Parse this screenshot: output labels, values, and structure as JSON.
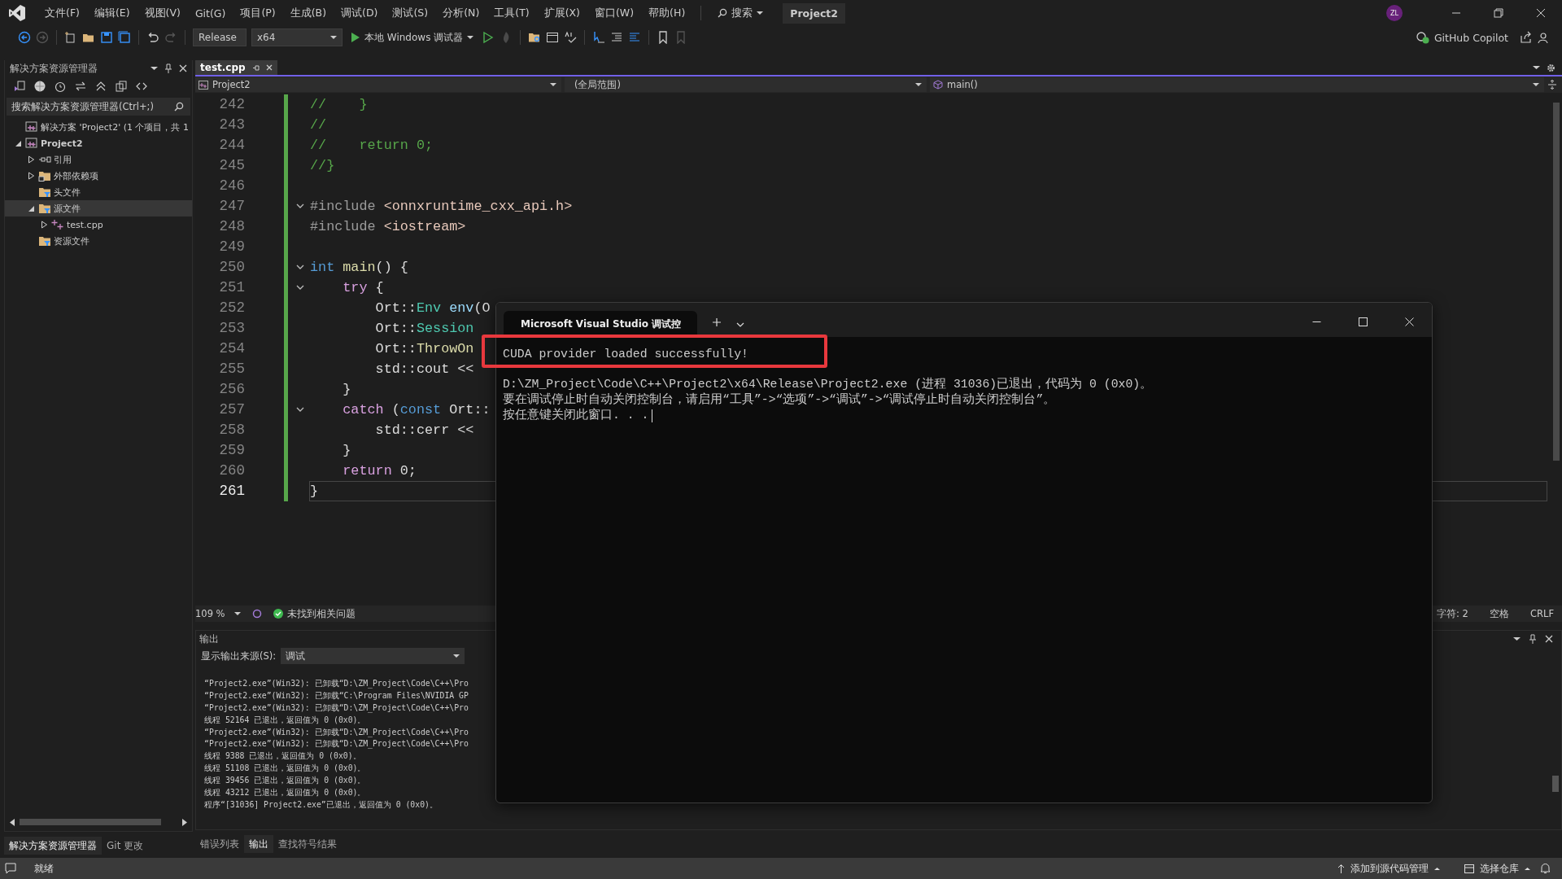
{
  "menu_bar": {
    "items": [
      "文件(F)",
      "编辑(E)",
      "视图(V)",
      "Git(G)",
      "项目(P)",
      "生成(B)",
      "调试(D)",
      "测试(S)",
      "分析(N)",
      "工具(T)",
      "扩展(X)",
      "窗口(W)",
      "帮助(H)"
    ],
    "search": "搜索",
    "title": "Project2",
    "avatar": "ZL"
  },
  "toolbar": {
    "configuration": "Release",
    "platform": "x64",
    "debugger": "本地 Windows 调试器",
    "copilot": "GitHub Copilot"
  },
  "solution_explorer": {
    "title": "解决方案资源管理器",
    "search_placeholder": "搜索解决方案资源管理器(Ctrl+;)",
    "tree": [
      {
        "label": "解决方案 'Project2' (1 个项目，共 1",
        "kind": "solution",
        "selected": false
      },
      {
        "label": "Project2",
        "kind": "project",
        "expanded": true,
        "selected": false,
        "children": [
          {
            "label": "引用",
            "kind": "references",
            "expanded": false,
            "selected": false
          },
          {
            "label": "外部依赖项",
            "kind": "external",
            "expanded": false,
            "selected": false
          },
          {
            "label": "头文件",
            "kind": "filter",
            "selected": false
          },
          {
            "label": "源文件",
            "kind": "filter",
            "expanded": true,
            "selected": true,
            "children": [
              {
                "label": "test.cpp",
                "kind": "cpp",
                "expanded": false,
                "selected": false
              }
            ]
          },
          {
            "label": "资源文件",
            "kind": "filter",
            "selected": false
          }
        ]
      }
    ]
  },
  "editor": {
    "tabs": [
      {
        "label": "test.cpp",
        "selected": true
      }
    ],
    "nav": {
      "project": "Project2",
      "scope": "(全局范围)",
      "member": "main()"
    },
    "lines": [
      {
        "num": "242",
        "current": false,
        "segs": [
          {
            "kind": "comment",
            "t": "//    }"
          }
        ]
      },
      {
        "num": "243",
        "current": false,
        "segs": [
          {
            "kind": "comment",
            "t": "//"
          }
        ]
      },
      {
        "num": "244",
        "current": false,
        "segs": [
          {
            "kind": "comment",
            "t": "//    return 0;"
          }
        ]
      },
      {
        "num": "245",
        "current": false,
        "segs": [
          {
            "kind": "comment",
            "t": "//}"
          }
        ]
      },
      {
        "num": "246",
        "current": false
      },
      {
        "num": "247",
        "fold": true,
        "current": false,
        "segs": [
          {
            "kind": "pre",
            "t": "#include "
          },
          {
            "kind": "inc",
            "t": "<onnxruntime_cxx_api.h>"
          }
        ]
      },
      {
        "num": "248",
        "current": false,
        "segs": [
          {
            "kind": "pre",
            "t": "#include "
          },
          {
            "kind": "inc",
            "t": "<iostream>"
          }
        ]
      },
      {
        "num": "249",
        "current": false
      },
      {
        "num": "250",
        "fold": true,
        "current": false,
        "segs": [
          {
            "kind": "kw",
            "t": "int "
          },
          {
            "kind": "fn",
            "t": "main"
          },
          {
            "kind": "plain",
            "t": "() {"
          }
        ]
      },
      {
        "num": "251",
        "fold": true,
        "current": false,
        "segs": [
          {
            "kind": "ctl",
            "t": "    try"
          },
          {
            "kind": "plain",
            "t": " {"
          }
        ]
      },
      {
        "num": "252",
        "current": false,
        "segs": [
          {
            "kind": "plain",
            "t": "        Ort::"
          },
          {
            "kind": "type",
            "t": "Env "
          },
          {
            "kind": "var",
            "t": "env"
          },
          {
            "kind": "plain",
            "t": "(O"
          }
        ]
      },
      {
        "num": "253",
        "current": false,
        "segs": [
          {
            "kind": "plain",
            "t": "        Ort::"
          },
          {
            "kind": "type",
            "t": "Session"
          }
        ]
      },
      {
        "num": "254",
        "current": false,
        "segs": [
          {
            "kind": "plain",
            "t": "        Ort::"
          },
          {
            "kind": "fn",
            "t": "ThrowOn"
          }
        ]
      },
      {
        "num": "255",
        "current": false,
        "segs": [
          {
            "kind": "plain",
            "t": "        std::cout <<"
          }
        ]
      },
      {
        "num": "256",
        "current": false,
        "segs": [
          {
            "kind": "plain",
            "t": "    }"
          }
        ]
      },
      {
        "num": "257",
        "fold": true,
        "current": false,
        "segs": [
          {
            "kind": "ctl",
            "t": "    catch"
          },
          {
            "kind": "plain",
            "t": " ("
          },
          {
            "kind": "kw",
            "t": "const"
          },
          {
            "kind": "plain",
            "t": " Ort::"
          }
        ]
      },
      {
        "num": "258",
        "current": false,
        "segs": [
          {
            "kind": "plain",
            "t": "        std::cerr <<"
          }
        ]
      },
      {
        "num": "259",
        "current": false,
        "segs": [
          {
            "kind": "plain",
            "t": "    }"
          }
        ]
      },
      {
        "num": "260",
        "current": false,
        "segs": [
          {
            "kind": "ctl",
            "t": "    return"
          },
          {
            "kind": "plain",
            "t": " 0;"
          }
        ]
      },
      {
        "num": "261",
        "current": true,
        "segs": [
          {
            "kind": "plain",
            "t": "}"
          }
        ]
      }
    ],
    "status": {
      "zoom": "109 %",
      "issues": "未找到相关问题",
      "char": "字符: 2",
      "spacing": "空格",
      "line_ending": "CRLF"
    }
  },
  "output": {
    "title": "输出",
    "source_label": "显示输出来源(S):",
    "source": "调试",
    "lines": [
      "“Project2.exe”(Win32): 已卸载“D:\\ZM_Project\\Code\\C++\\Pro",
      "“Project2.exe”(Win32): 已卸载“C:\\Program Files\\NVIDIA GP",
      "“Project2.exe”(Win32): 已卸载“D:\\ZM_Project\\Code\\C++\\Pro",
      "线程 52164 已退出，返回值为 0 (0x0)。",
      "“Project2.exe”(Win32): 已卸载“D:\\ZM_Project\\Code\\C++\\Pro",
      "“Project2.exe”(Win32): 已卸载“D:\\ZM_Project\\Code\\C++\\Pro",
      "线程 9388 已退出，返回值为 0 (0x0)。",
      "线程 51108 已退出，返回值为 0 (0x0)。",
      "线程 39456 已退出，返回值为 0 (0x0)。",
      "线程 43212 已退出，返回值为 0 (0x0)。",
      "程序“[31036] Project2.exe”已退出，返回值为 0 (0x0)。"
    ]
  },
  "bottom_tabs_left": [
    {
      "label": "解决方案资源管理器",
      "selected": true
    },
    {
      "label": "Git 更改",
      "selected": false
    }
  ],
  "bottom_tabs_center": [
    {
      "label": "错误列表",
      "selected": false
    },
    {
      "label": "输出",
      "selected": true
    },
    {
      "label": "查找符号结果",
      "selected": false
    }
  ],
  "console": {
    "tab_title": "Microsoft Visual Studio 调试控",
    "lines": [
      {
        "text": "CUDA provider loaded successfully!",
        "highlighted": true
      },
      {
        "text": "D:\\ZM_Project\\Code\\C++\\Project2\\x64\\Release\\Project2.exe (进程 31036)已退出，代码为 0 (0x0)。"
      },
      {
        "text": "要在调试停止时自动关闭控制台，请启用“工具”->“选项”->“调试”->“调试停止时自动关闭控制台”。"
      },
      {
        "text": "按任意键关闭此窗口. . .",
        "cursor": true
      }
    ]
  },
  "status_bar": {
    "message": "就绪",
    "source_control": "添加到源代码管理",
    "repository": "选择仓库"
  }
}
